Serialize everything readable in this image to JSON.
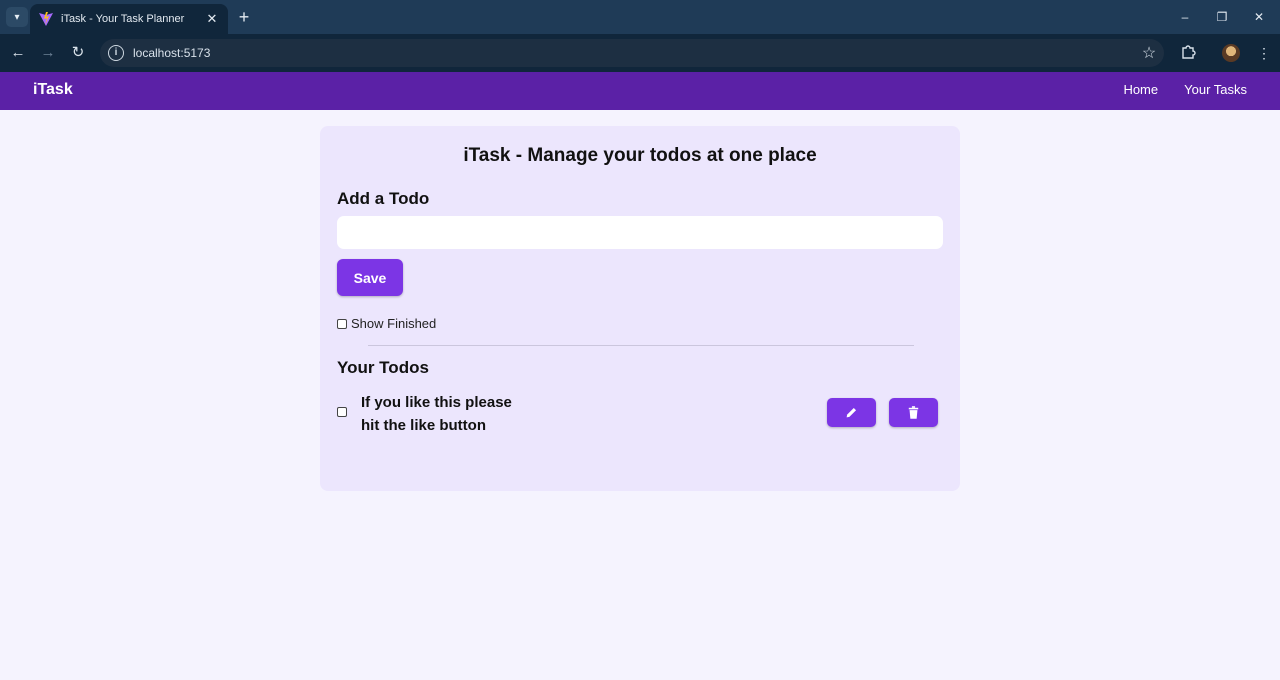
{
  "browser": {
    "tab_title": "iTask - Your Task Planner",
    "url": "localhost:5173"
  },
  "navbar": {
    "brand": "iTask",
    "links": [
      "Home",
      "Your Tasks"
    ]
  },
  "main": {
    "title": "iTask - Manage your todos at one place",
    "add_heading": "Add a Todo",
    "input": {
      "value": "",
      "placeholder": ""
    },
    "save_label": "Save",
    "show_finished_label": "Show Finished",
    "show_finished_checked": false,
    "todos_heading": "Your Todos",
    "todos": [
      {
        "text": "If you like this please hit the like button",
        "completed": false
      }
    ]
  },
  "colors": {
    "navbar": "#5b21a6",
    "accent": "#7c35e5",
    "card": "#ece6fd",
    "page_bg": "#f5f3fe"
  },
  "icons": {
    "edit": "pencil-icon",
    "delete": "trash-icon"
  }
}
